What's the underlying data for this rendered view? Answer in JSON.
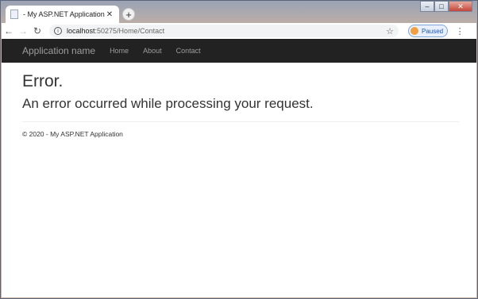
{
  "browser": {
    "tab_title": "- My ASP.NET Application",
    "tab_close": "✕",
    "new_tab": "+",
    "url_host": "localhost",
    "url_path": ":50275/Home/Contact",
    "profile_status": "Paused",
    "window_controls": {
      "minimize": "–",
      "maximize": "□",
      "close": "✕"
    }
  },
  "site": {
    "brand": "Application name",
    "nav": [
      "Home",
      "About",
      "Contact"
    ],
    "error_title": "Error.",
    "error_message": "An error occurred while processing your request.",
    "footer": "© 2020 - My ASP.NET Application"
  },
  "colors": {
    "navbar": "#222222",
    "nav_text": "#9d9d9d",
    "accent": "#1a56b8"
  }
}
